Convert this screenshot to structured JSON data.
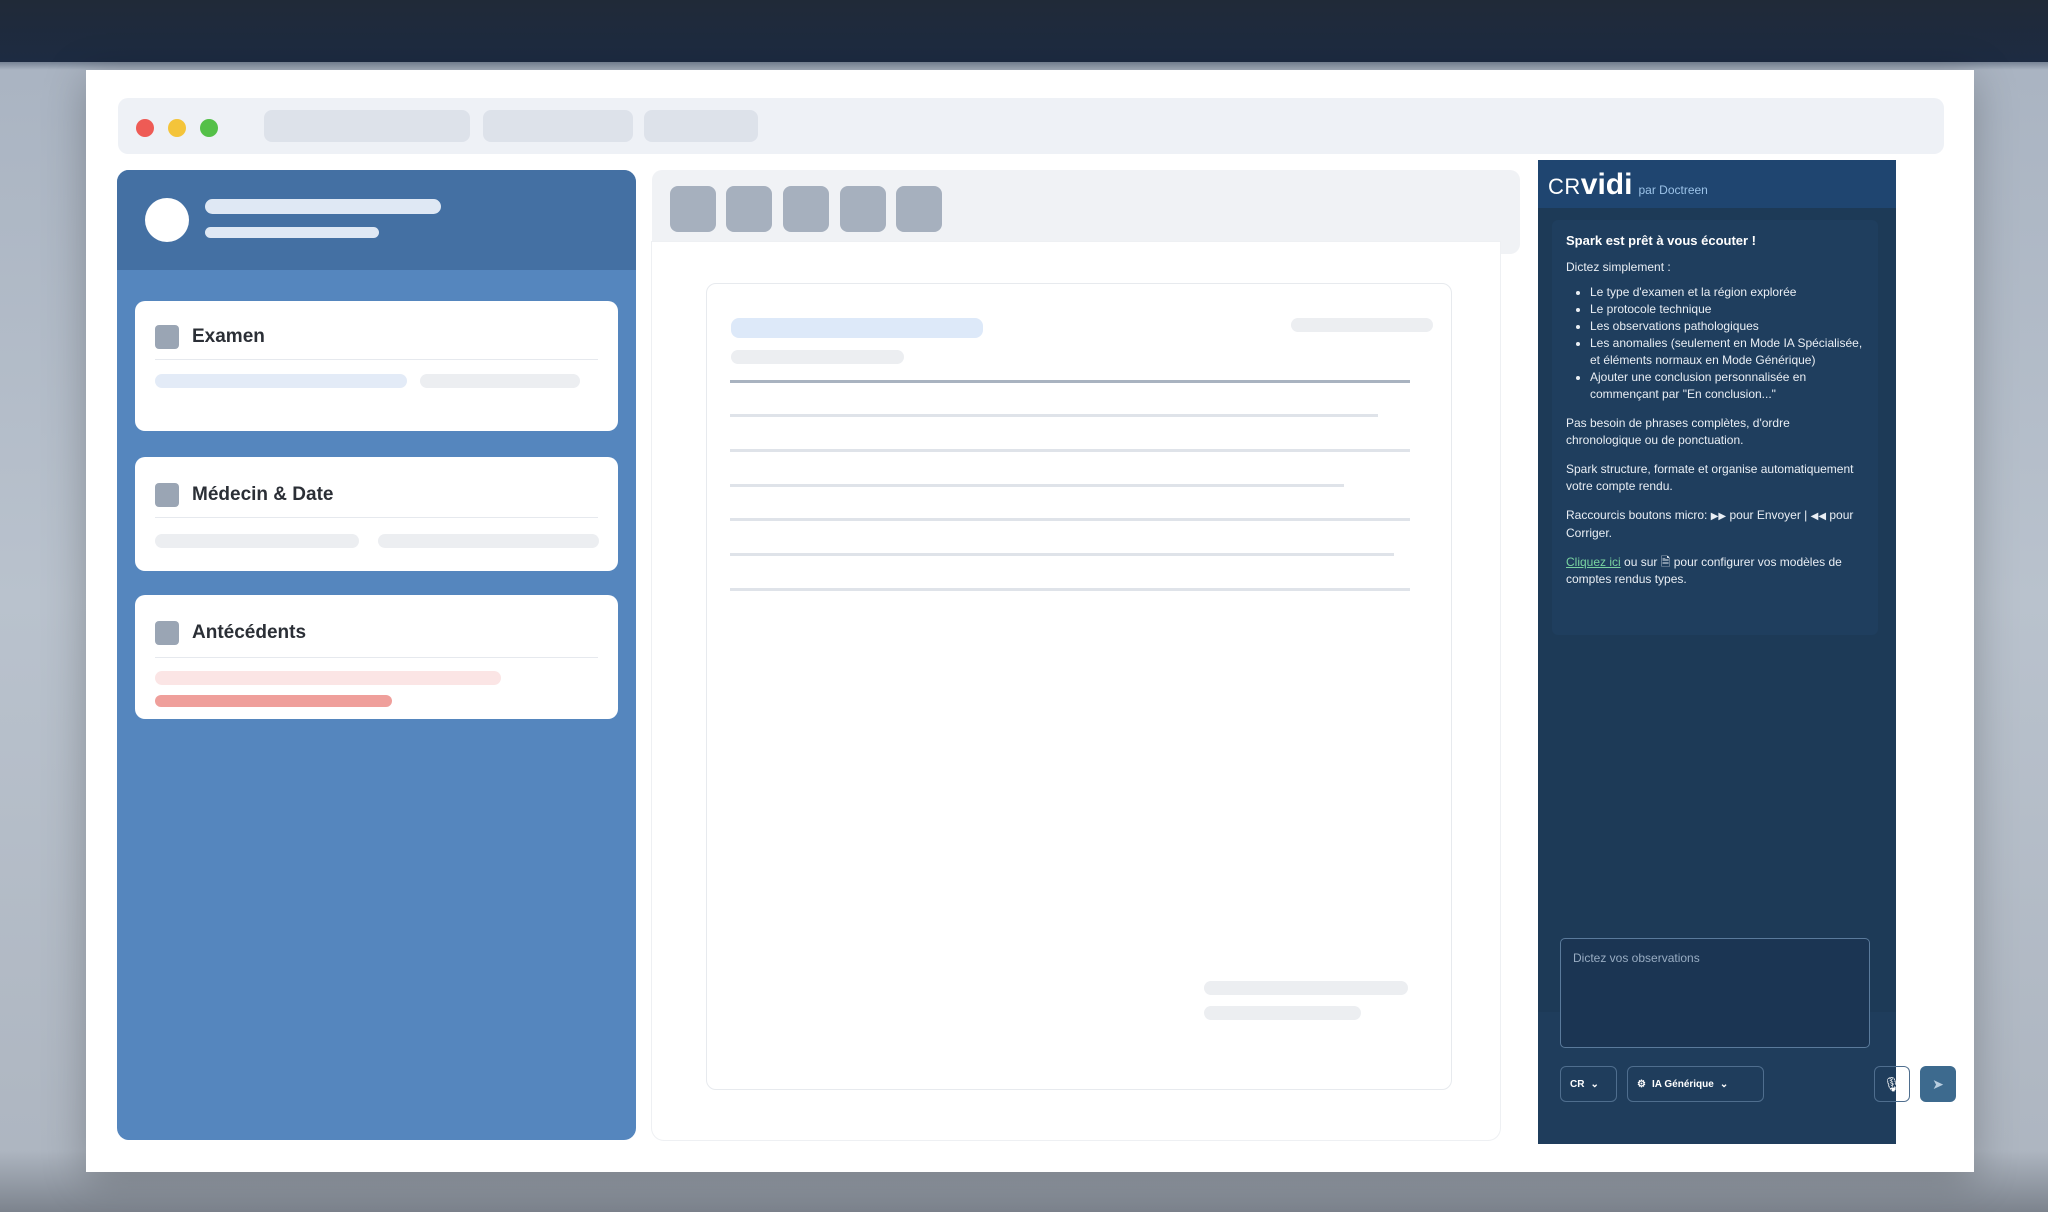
{
  "sidebar": {
    "cards": [
      {
        "title": "Examen"
      },
      {
        "title": "Médecin & Date"
      },
      {
        "title": "Antécédents"
      }
    ]
  },
  "assistant": {
    "logo": {
      "cr": "CR",
      "vidi": "vidi",
      "par": "par Doctreen"
    },
    "message": {
      "title": "Spark est prêt à vous écouter !",
      "intro": "Dictez simplement :",
      "items": [
        "Le type d'examen et la région explorée",
        "Le protocole technique",
        "Les observations pathologiques",
        "Les anomalies (seulement en Mode IA Spécialisée, et éléments normaux en Mode Générique)",
        "Ajouter une conclusion personnalisée en commençant par \"En conclusion...\""
      ],
      "p1": "Pas besoin de phrases complètes, d'ordre chronologique ou de ponctuation.",
      "p2": "Spark structure, formate et organise automatiquement votre compte rendu.",
      "shortcuts_prefix": "Raccourcis boutons micro:",
      "shortcuts_send": "pour Envoyer |",
      "shortcuts_fix": "pour Corriger.",
      "link": "Cliquez ici",
      "link_mid": "ou sur",
      "link_suffix": "pour configurer vos modèles de comptes rendus types."
    },
    "input_placeholder": "Dictez vos observations",
    "mode_select": "CR",
    "ai_select": "IA Générique"
  },
  "icons": {
    "mic": "microphone-icon",
    "send": "send-icon",
    "forward": "fast-forward-icon",
    "rewind": "rewind-icon",
    "doc": "document-icon",
    "ai": "ai-robot-icon"
  },
  "colors": {
    "sidebar": "#5586be",
    "panel": "#1d3a57",
    "link": "#78d2a0"
  }
}
